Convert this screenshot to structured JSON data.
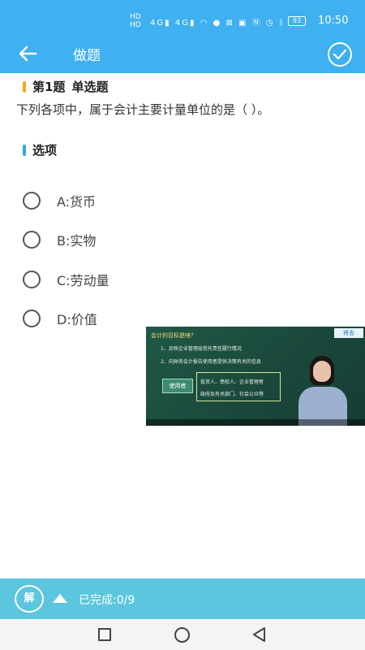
{
  "status_bar": {
    "network_badges": [
      "HD",
      "HD"
    ],
    "signal_labels": [
      "4G",
      "4G"
    ],
    "battery": "93",
    "time": "10:50"
  },
  "app_bar": {
    "title": "做题"
  },
  "question": {
    "number_label": "第1题",
    "type_label": "单选题",
    "text": "下列各项中，属于会计主要计量单位的是（ ）。"
  },
  "options_header": "选项",
  "options": [
    {
      "label": "A:货币"
    },
    {
      "label": "B:实物"
    },
    {
      "label": "C:劳动量"
    },
    {
      "label": "D:价值"
    }
  ],
  "video": {
    "title": "会计的目标是啥？",
    "line1": "1、反映企业管理层受托责任履行情况",
    "line2": "2、向财务会计报告使用者提供决策有关的信息",
    "tag": "使用者",
    "box_line1": "投资人、债权人、企业管理者",
    "box_line2": "政府及有关部门、社会公众等",
    "logo": "将去"
  },
  "bottom_bar": {
    "answer_button": "解",
    "progress_label": "已完成:0/9"
  },
  "colors": {
    "primary": "#3fb0f0",
    "bottom_bar": "#5cc6de",
    "question_accent": "#f6a623",
    "options_accent": "#2fa8e0"
  }
}
